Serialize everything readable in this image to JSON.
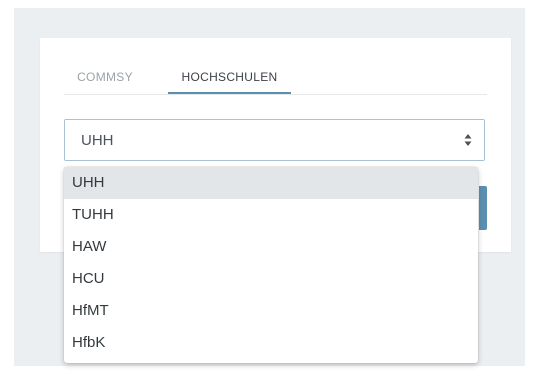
{
  "tabs": [
    {
      "label": "COMMSY",
      "active": false
    },
    {
      "label": "HOCHSCHULEN",
      "active": true
    }
  ],
  "select": {
    "value": "UHH",
    "icon": "sort-arrows-icon"
  },
  "dropdown": {
    "options": [
      "UHH",
      "TUHH",
      "HAW",
      "HCU",
      "HfMT",
      "HfbK"
    ],
    "highlighted": "UHH"
  },
  "colors": {
    "accent": "#5b8fb0",
    "background": "#eceff2",
    "highlight": "#e3e6e9"
  }
}
